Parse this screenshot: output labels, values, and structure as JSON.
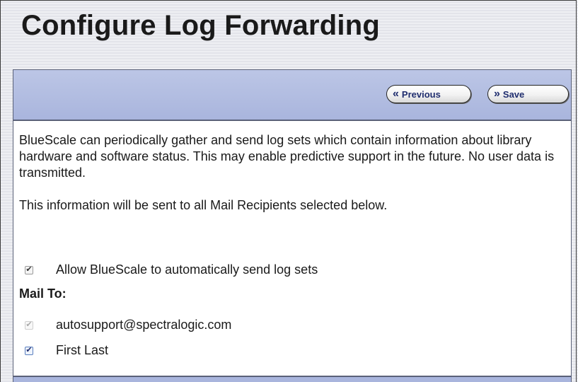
{
  "page": {
    "title": "Configure Log Forwarding"
  },
  "toolbar": {
    "previous_label": "Previous",
    "save_label": "Save"
  },
  "body": {
    "intro": "BlueScale can periodically gather and send log sets which contain information about library hardware and software status. This may enable predictive support in the future. No user data is transmitted.",
    "recipients_note": "This information will be sent to all Mail Recipients selected below.",
    "allow_option": {
      "label": "Allow BlueScale to automatically send log sets",
      "checked": true
    },
    "mail_to_label": "Mail To:",
    "recipients": [
      {
        "label": "autosupport@spectralogic.com",
        "checked": true,
        "disabled": true
      },
      {
        "label": "First Last",
        "checked": true,
        "disabled": false
      }
    ]
  },
  "icons": {
    "previous": "double-chevron-left-icon",
    "save": "double-chevron-right-icon",
    "check": "checkmark-icon"
  },
  "colors": {
    "header_bar": "#a9b5dd",
    "button_text": "#1f2d6e",
    "page_background": "#e9eaef"
  }
}
